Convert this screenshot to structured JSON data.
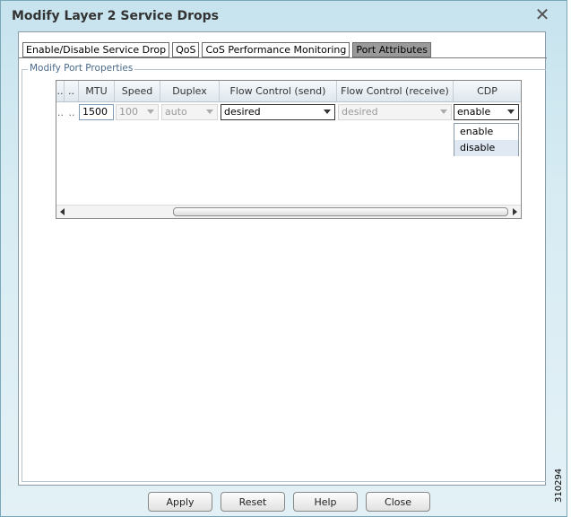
{
  "window": {
    "title": "Modify Layer 2 Service Drops"
  },
  "tabs": [
    {
      "label": "Enable/Disable Service Drop",
      "active": false
    },
    {
      "label": "QoS",
      "active": false
    },
    {
      "label": "CoS Performance Monitoring",
      "active": false
    },
    {
      "label": "Port Attributes",
      "active": true
    }
  ],
  "section": {
    "legend": "Modify Port Properties"
  },
  "table": {
    "columns": [
      "..",
      "..",
      "MTU",
      "Speed",
      "Duplex",
      "Flow Control (send)",
      "Flow Control (receive)",
      "CDP"
    ],
    "row": {
      "dot1": "..",
      "dot2": "..",
      "mtu": "1500",
      "speed": "100",
      "duplex": "auto",
      "flow_send": "desired",
      "flow_receive": "desired",
      "cdp": "enable"
    }
  },
  "cdp_dropdown": {
    "options": [
      "enable",
      "disable"
    ],
    "highlighted": "disable"
  },
  "buttons": {
    "apply": "Apply",
    "reset": "Reset",
    "help": "Help",
    "close": "Close"
  },
  "figure_number": "310294",
  "icons": {
    "close": "close-icon"
  }
}
